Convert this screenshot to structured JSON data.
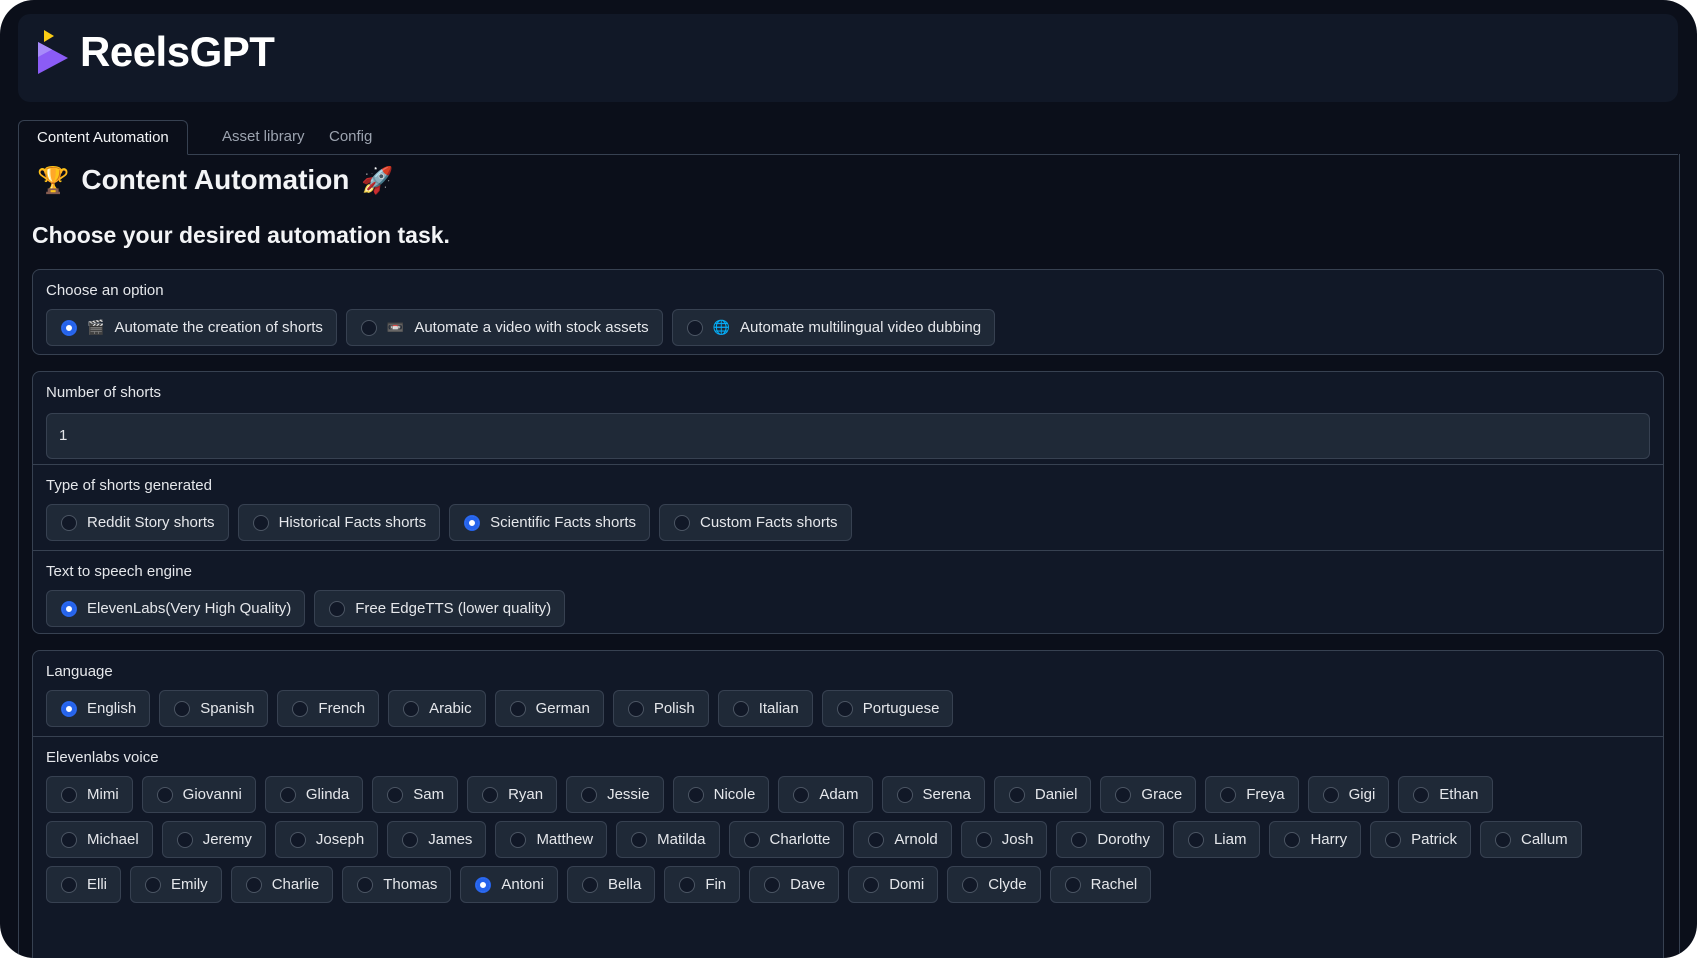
{
  "app": {
    "title": "ReelsGPT"
  },
  "tabs": [
    {
      "label": "Content Automation",
      "active": true
    },
    {
      "label": "Asset library",
      "active": false
    },
    {
      "label": "Config",
      "active": false
    }
  ],
  "page": {
    "title": "Content Automation",
    "title_icon_left": "🏆",
    "title_icon_right": "🚀",
    "subtitle": "Choose your desired automation task."
  },
  "task": {
    "label": "Choose an option",
    "options": [
      {
        "icon": "🎬",
        "label": "Automate the creation of shorts",
        "selected": true
      },
      {
        "icon": "📼",
        "label": "Automate a video with stock assets",
        "selected": false
      },
      {
        "icon": "🌐",
        "label": "Automate multilingual video dubbing",
        "selected": false
      }
    ]
  },
  "shorts": {
    "count_label": "Number of shorts",
    "count_value": "1",
    "type_label": "Type of shorts generated",
    "types": [
      {
        "label": "Reddit Story shorts",
        "selected": false
      },
      {
        "label": "Historical Facts shorts",
        "selected": false
      },
      {
        "label": "Scientific Facts shorts",
        "selected": true
      },
      {
        "label": "Custom Facts shorts",
        "selected": false
      }
    ],
    "tts_label": "Text to speech engine",
    "tts": [
      {
        "label": "ElevenLabs(Very High Quality)",
        "selected": true
      },
      {
        "label": "Free EdgeTTS (lower quality)",
        "selected": false
      }
    ]
  },
  "language": {
    "label": "Language",
    "options": [
      {
        "label": "English",
        "selected": true
      },
      {
        "label": "Spanish",
        "selected": false
      },
      {
        "label": "French",
        "selected": false
      },
      {
        "label": "Arabic",
        "selected": false
      },
      {
        "label": "German",
        "selected": false
      },
      {
        "label": "Polish",
        "selected": false
      },
      {
        "label": "Italian",
        "selected": false
      },
      {
        "label": "Portuguese",
        "selected": false
      }
    ]
  },
  "voice": {
    "label": "Elevenlabs voice",
    "options": [
      {
        "label": "Mimi",
        "selected": false
      },
      {
        "label": "Giovanni",
        "selected": false
      },
      {
        "label": "Glinda",
        "selected": false
      },
      {
        "label": "Sam",
        "selected": false
      },
      {
        "label": "Ryan",
        "selected": false
      },
      {
        "label": "Jessie",
        "selected": false
      },
      {
        "label": "Nicole",
        "selected": false
      },
      {
        "label": "Adam",
        "selected": false
      },
      {
        "label": "Serena",
        "selected": false
      },
      {
        "label": "Daniel",
        "selected": false
      },
      {
        "label": "Grace",
        "selected": false
      },
      {
        "label": "Freya",
        "selected": false
      },
      {
        "label": "Gigi",
        "selected": false
      },
      {
        "label": "Ethan",
        "selected": false
      },
      {
        "label": "Michael",
        "selected": false
      },
      {
        "label": "Jeremy",
        "selected": false
      },
      {
        "label": "Joseph",
        "selected": false
      },
      {
        "label": "James",
        "selected": false
      },
      {
        "label": "Matthew",
        "selected": false
      },
      {
        "label": "Matilda",
        "selected": false
      },
      {
        "label": "Charlotte",
        "selected": false
      },
      {
        "label": "Arnold",
        "selected": false
      },
      {
        "label": "Josh",
        "selected": false
      },
      {
        "label": "Dorothy",
        "selected": false
      },
      {
        "label": "Liam",
        "selected": false
      },
      {
        "label": "Harry",
        "selected": false
      },
      {
        "label": "Patrick",
        "selected": false
      },
      {
        "label": "Callum",
        "selected": false
      },
      {
        "label": "Elli",
        "selected": false
      },
      {
        "label": "Emily",
        "selected": false
      },
      {
        "label": "Charlie",
        "selected": false
      },
      {
        "label": "Thomas",
        "selected": false
      },
      {
        "label": "Antoni",
        "selected": true
      },
      {
        "label": "Bella",
        "selected": false
      },
      {
        "label": "Fin",
        "selected": false
      },
      {
        "label": "Dave",
        "selected": false
      },
      {
        "label": "Domi",
        "selected": false
      },
      {
        "label": "Clyde",
        "selected": false
      },
      {
        "label": "Rachel",
        "selected": false
      }
    ]
  },
  "colors": {
    "background": "#0b0f1a",
    "panel": "#111827",
    "accent": "#2563eb",
    "logo_purple": "#8b5cf6",
    "logo_yellow": "#facc15"
  }
}
